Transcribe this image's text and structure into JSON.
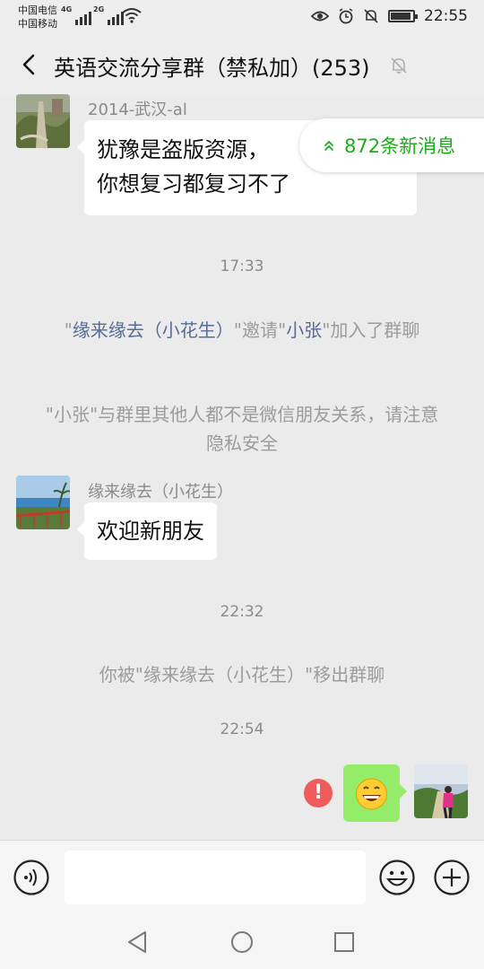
{
  "status_bar": {
    "carrier_1": "中国电信",
    "carrier_2": "中国移动",
    "network_1": "4G",
    "network_2": "2G",
    "time": "22:55",
    "icons": [
      "signal-icon",
      "wifi-icon",
      "eye-icon",
      "alarm-icon",
      "mute-icon",
      "battery-icon"
    ],
    "battery_level": 0.85
  },
  "header": {
    "title": "英语交流分享群（禁私加）(253)",
    "icons": [
      "back-arrow-icon",
      "muted-bell-icon"
    ]
  },
  "new_messages": {
    "label": "872条新消息",
    "icon": "double-chevron-up-icon"
  },
  "messages": [
    {
      "sender": "2014-武汉-al",
      "line_1": "犹豫是盗版资源，",
      "line_2": "你想复习都复习不了",
      "avatar": "landscape-avatar"
    },
    {
      "sender": "缘来缘去（小花生）",
      "text": "欢迎新朋友",
      "avatar": "seaside-avatar"
    },
    {
      "self_emoji": "😄",
      "status": "!",
      "avatar": "self-avatar"
    }
  ],
  "timestamps": [
    "17:33",
    "22:32",
    "22:54"
  ],
  "system_messages": {
    "invite": {
      "q1": "\"",
      "inviter": "缘来缘去（小花生）",
      "mid": "\"邀请\"",
      "invitee": "小张",
      "tail": "\"加入了群聊"
    },
    "privacy": "\"小张\"与群里其他人都不是微信朋友关系，请注意隐私安全",
    "removed": "你被\"缘来缘去（小花生）\"移出群聊"
  },
  "input_bar": {
    "icons": [
      "voice-icon",
      "emoji-icon",
      "plus-icon"
    ],
    "text": ""
  },
  "nav_bar": {
    "icons": [
      "nav-back-icon",
      "nav-home-icon",
      "nav-recent-icon"
    ]
  },
  "colors": {
    "background": "#ebebeb",
    "bubble_self": "#95ec69",
    "link": "#576b95",
    "new_msg": "#1aad19",
    "error": "#f05b5b"
  }
}
